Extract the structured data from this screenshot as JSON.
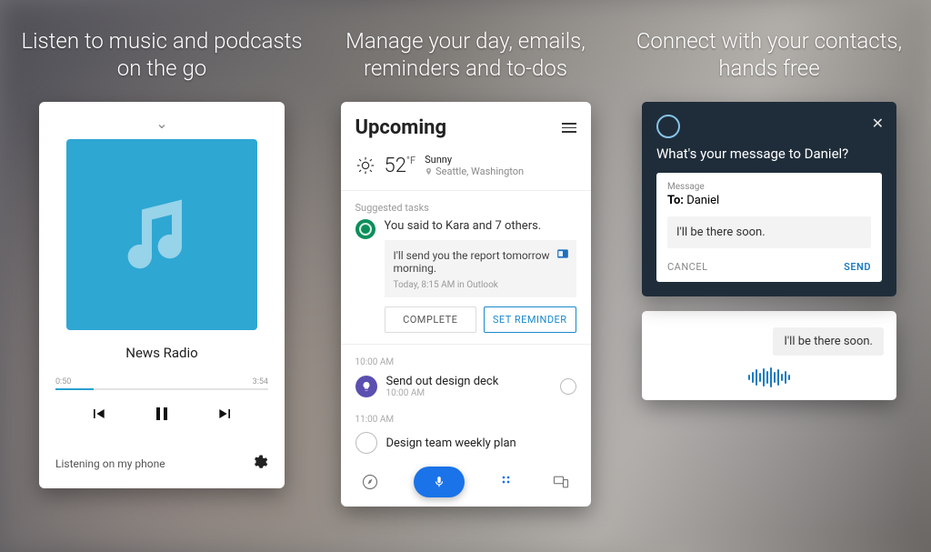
{
  "panels": {
    "music": {
      "headline": "Listen to music and podcasts on the go",
      "track": "News Radio",
      "time_elapsed": "0:50",
      "time_total": "3:54",
      "footer": "Listening on my phone"
    },
    "upcoming": {
      "headline": "Manage your day, emails, reminders and to-dos",
      "title": "Upcoming",
      "weather": {
        "temp": "52",
        "unit": "°F",
        "condition": "Sunny",
        "location": "Seattle, Washington"
      },
      "suggested_label": "Suggested tasks",
      "suggestion": {
        "title": "You said to Kara and 7 others.",
        "body": "I'll send you the report tomorrow morning.",
        "meta": "Today, 8:15 AM in Outlook"
      },
      "btn_complete": "COMPLETE",
      "btn_reminder": "SET REMINDER",
      "slot1_time": "10:00 AM",
      "event1": {
        "title": "Send out design deck",
        "sub": "10:00 AM"
      },
      "slot2_time": "11:00 AM",
      "event2": {
        "title": "Design team weekly plan"
      }
    },
    "compose": {
      "headline": "Connect with your contacts, hands free",
      "prompt": "What's your message to Daniel?",
      "label": "Message",
      "to_prefix": "To:",
      "to_name": "Daniel",
      "body": "I'll be there soon.",
      "cancel": "CANCEL",
      "send": "SEND",
      "reply_bubble": "I'll be there soon."
    }
  }
}
